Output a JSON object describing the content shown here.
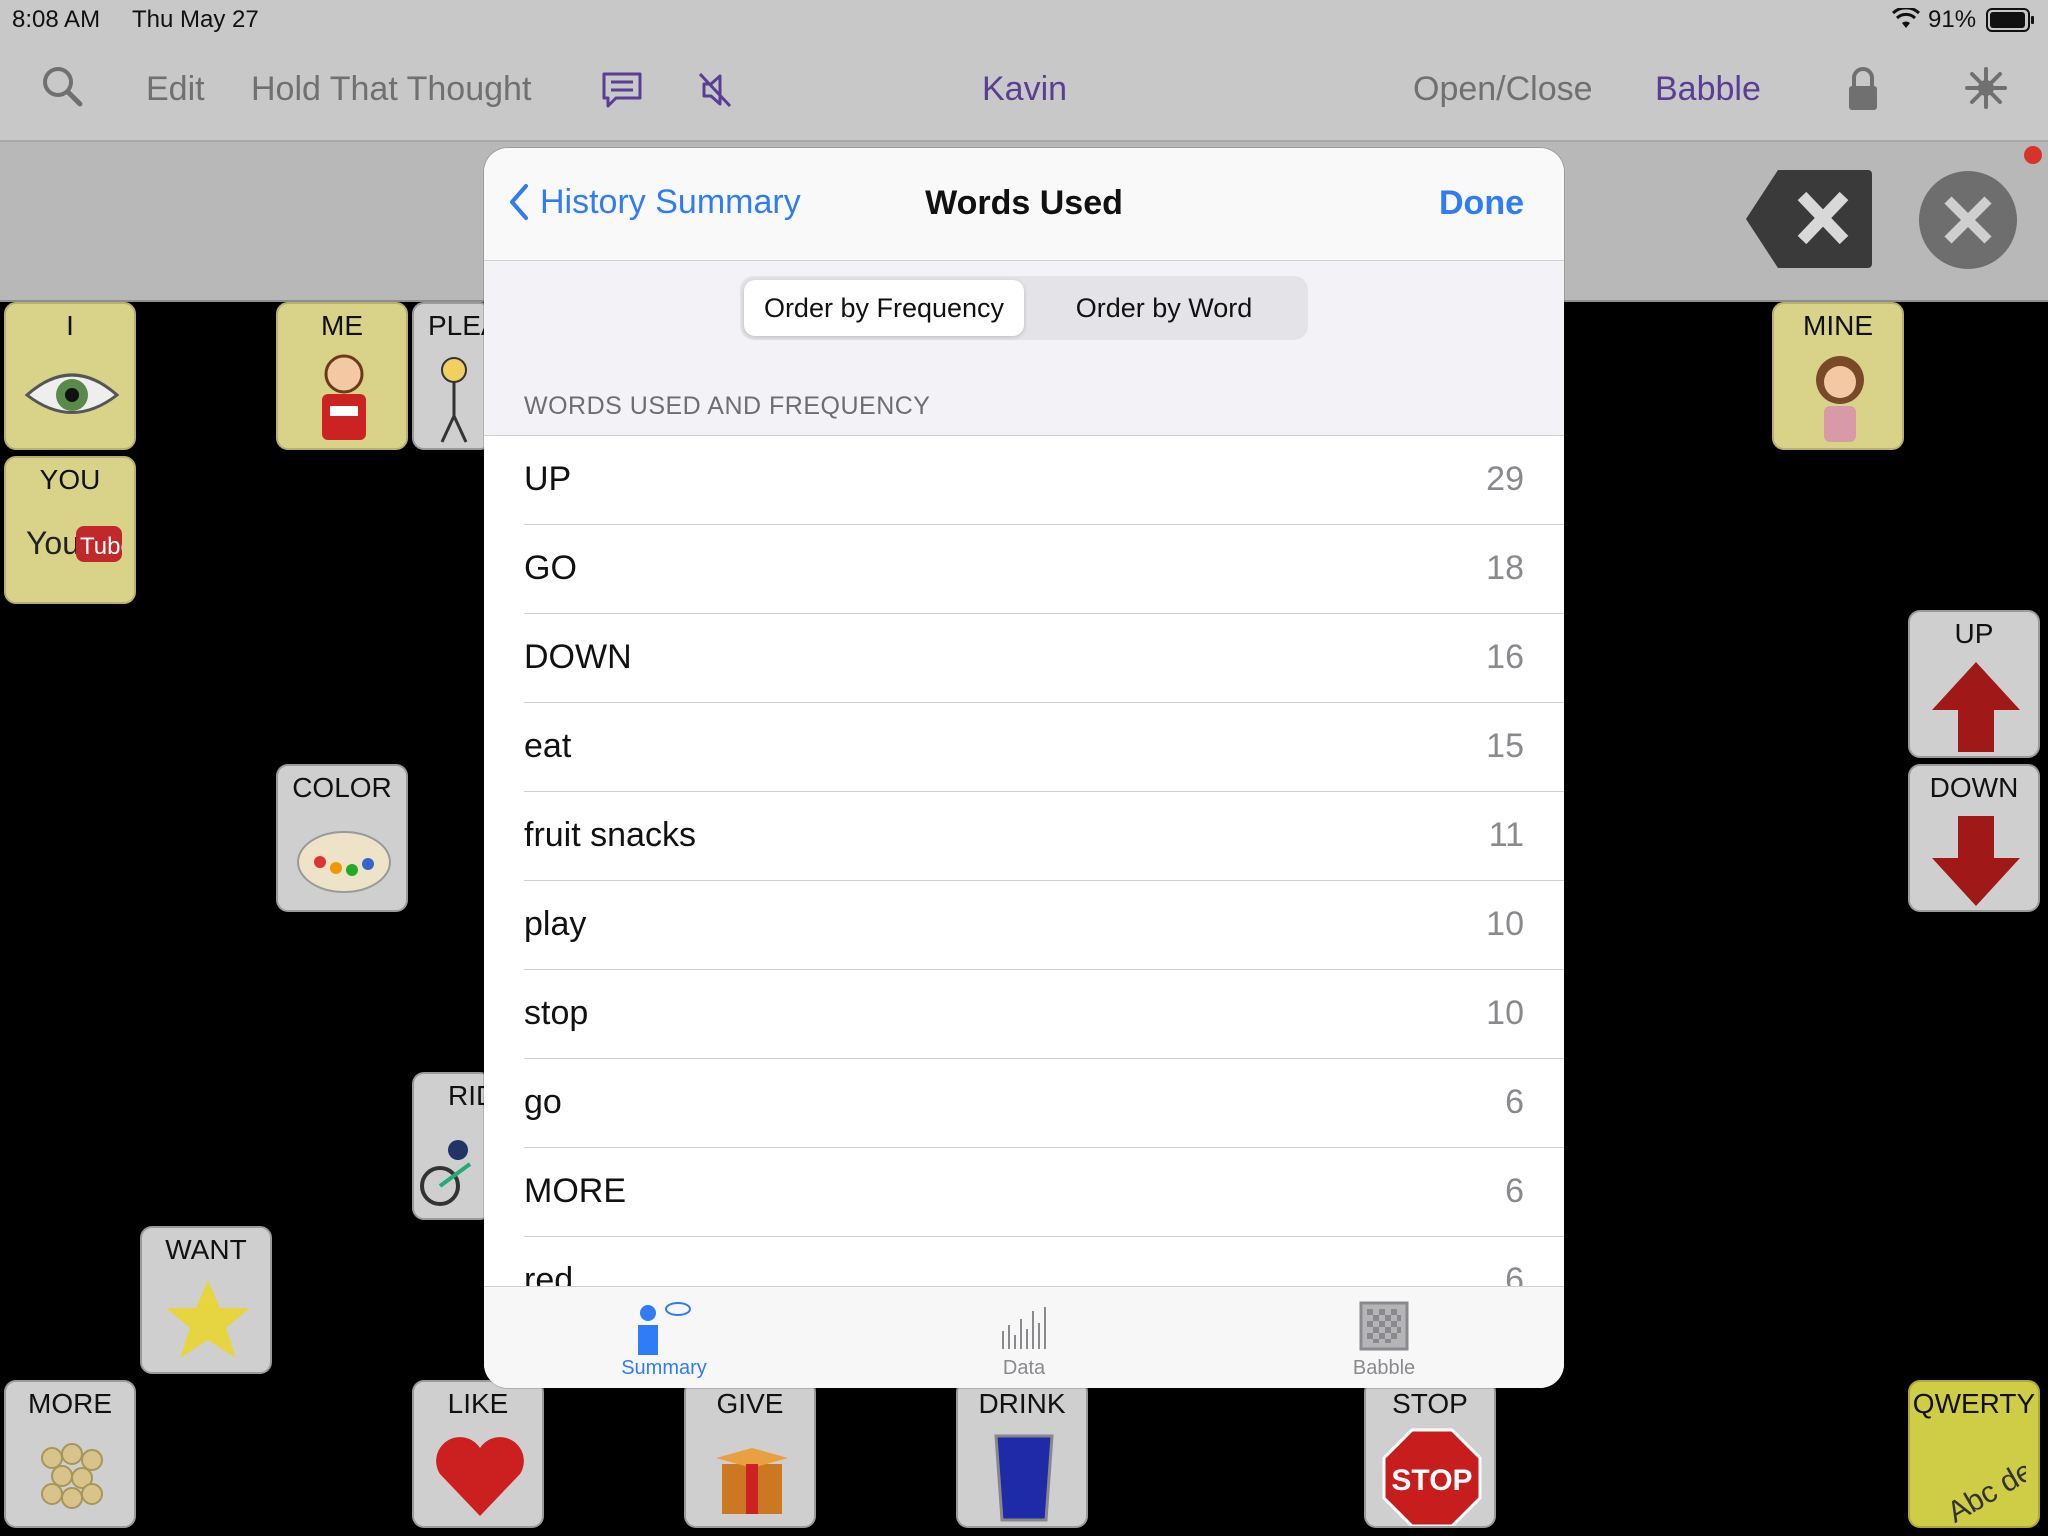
{
  "status": {
    "time": "8:08 AM",
    "date": "Thu May 27",
    "battery": "91%"
  },
  "toolbar": {
    "edit": "Edit",
    "hold_that_thought": "Hold That Thought",
    "user": "Kavin",
    "open_close": "Open/Close",
    "babble": "Babble"
  },
  "tiles": {
    "i": "I",
    "me": "ME",
    "please": "PLEA",
    "mine": "MINE",
    "you": "YOU",
    "up": "UP",
    "color": "COLOR",
    "down": "DOWN",
    "ride": "RID",
    "want": "WANT",
    "more": "MORE",
    "like": "LIKE",
    "give": "GIVE",
    "drink": "DRINK",
    "stop": "STOP",
    "qwerty": "QWERTY"
  },
  "modal": {
    "back_label": "History Summary",
    "title": "Words Used",
    "done": "Done",
    "segments": [
      "Order by Frequency",
      "Order by Word"
    ],
    "selected_segment": "Order by Frequency",
    "section_header": "WORDS USED AND FREQUENCY",
    "words": [
      {
        "word": "UP",
        "count": "29"
      },
      {
        "word": "GO",
        "count": "18"
      },
      {
        "word": "DOWN",
        "count": "16"
      },
      {
        "word": "eat",
        "count": "15"
      },
      {
        "word": "fruit snacks",
        "count": "11"
      },
      {
        "word": "play",
        "count": "10"
      },
      {
        "word": "stop",
        "count": "10"
      },
      {
        "word": "go",
        "count": "6"
      },
      {
        "word": "MORE",
        "count": "6"
      },
      {
        "word": "red",
        "count": "6"
      }
    ],
    "tabs": [
      {
        "label": "Summary",
        "icon": "person-speech-icon",
        "active": true
      },
      {
        "label": "Data",
        "icon": "bar-chart-icon",
        "active": false
      },
      {
        "label": "Babble",
        "icon": "checkerboard-icon",
        "active": false
      }
    ]
  },
  "colors": {
    "accent": "#2f7cf6",
    "purple": "#5a3e96"
  }
}
